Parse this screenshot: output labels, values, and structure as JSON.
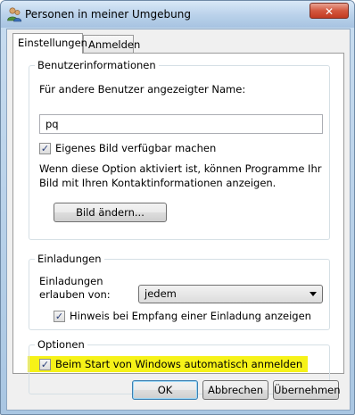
{
  "window": {
    "title": "Personen in meiner Umgebung",
    "close_glyph": "✕"
  },
  "tabs": [
    {
      "label": "Einstellungen"
    },
    {
      "label": "Anmelden"
    }
  ],
  "user_info": {
    "legend": "Benutzerinformationen",
    "name_label": "Für andere Benutzer angezeigter Name:",
    "name_value": "pq",
    "own_picture_label": "Eigenes Bild verfügbar machen",
    "own_picture_checked": true,
    "description_line1": "Wenn diese Option aktiviert ist, können Programme Ihr",
    "description_line2": "Bild mit Ihren Kontaktinformationen anzeigen.",
    "change_picture_button": "Bild ändern..."
  },
  "invitations": {
    "legend": "Einladungen",
    "allow_label_line1": "Einladungen",
    "allow_label_line2": "erlauben von:",
    "allow_value": "jedem",
    "notify_label": "Hinweis bei Empfang einer Einladung anzeigen",
    "notify_checked": true
  },
  "options": {
    "legend": "Optionen",
    "autostart_label": "Beim Start von Windows automatisch anmelden",
    "autostart_checked": true,
    "highlight_color": "#f6f218"
  },
  "buttons": {
    "ok": "OK",
    "cancel": "Abbrechen",
    "apply": "Übernehmen"
  },
  "check_glyph": "✓",
  "colors": {
    "title_bar": "#b9d1ea",
    "close_button": "#c23a22",
    "dialog_bg": "#f0f0f0"
  }
}
